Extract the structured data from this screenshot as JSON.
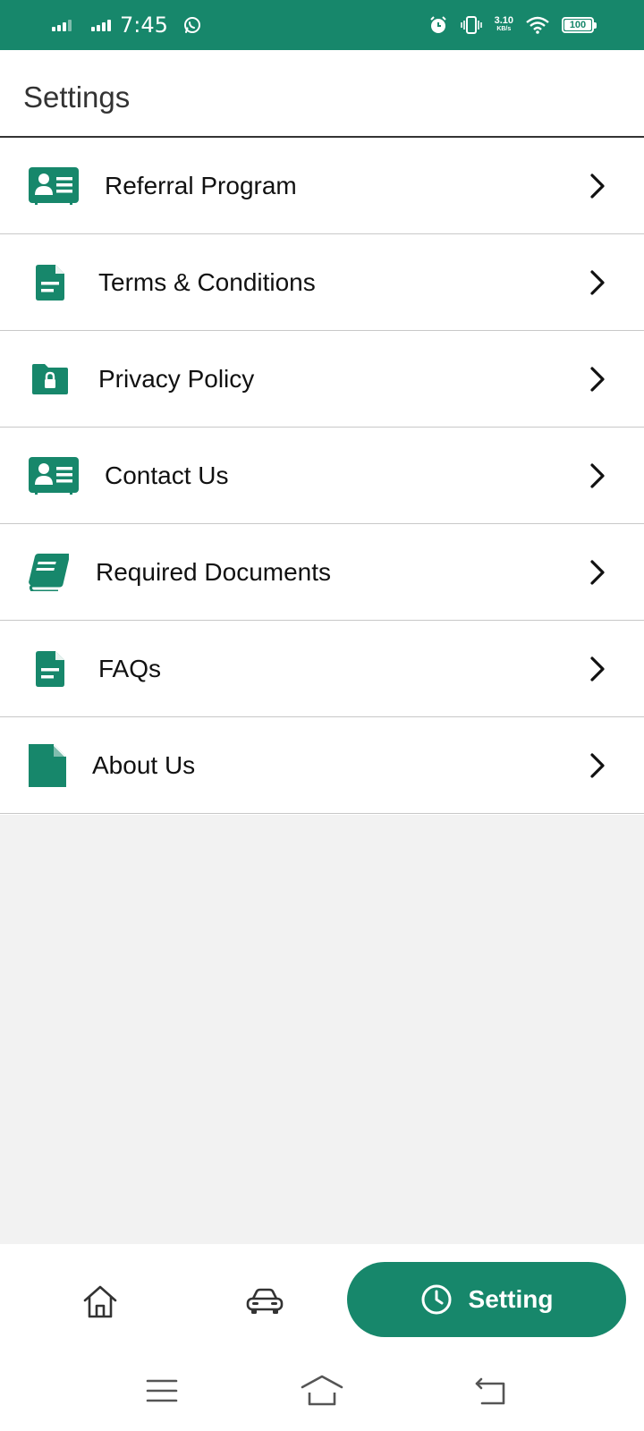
{
  "status_bar": {
    "time": "7:45",
    "net_speed_value": "3.10",
    "net_speed_unit": "KB/s",
    "battery_percent": 100,
    "battery_label": "100"
  },
  "header": {
    "title": "Settings"
  },
  "menu": {
    "items": [
      {
        "label": "Referral Program",
        "icon": "id-card-icon"
      },
      {
        "label": "Terms & Conditions",
        "icon": "document-icon"
      },
      {
        "label": "Privacy Policy",
        "icon": "folder-lock-icon"
      },
      {
        "label": "Contact Us",
        "icon": "id-card-icon"
      },
      {
        "label": "Required Documents",
        "icon": "book-icon"
      },
      {
        "label": "FAQs",
        "icon": "document-icon"
      },
      {
        "label": "About Us",
        "icon": "file-icon"
      }
    ]
  },
  "bottom_nav": {
    "home_icon": "home-icon",
    "car_icon": "car-icon",
    "setting_icon": "clock-icon",
    "setting_label": "Setting"
  },
  "system_nav": {
    "menu_icon": "menu-icon",
    "home_icon": "home-outline-icon",
    "back_icon": "back-icon"
  },
  "colors": {
    "accent": "#17876b",
    "background_empty": "#f2f2f2",
    "divider": "#c8c8c8"
  }
}
